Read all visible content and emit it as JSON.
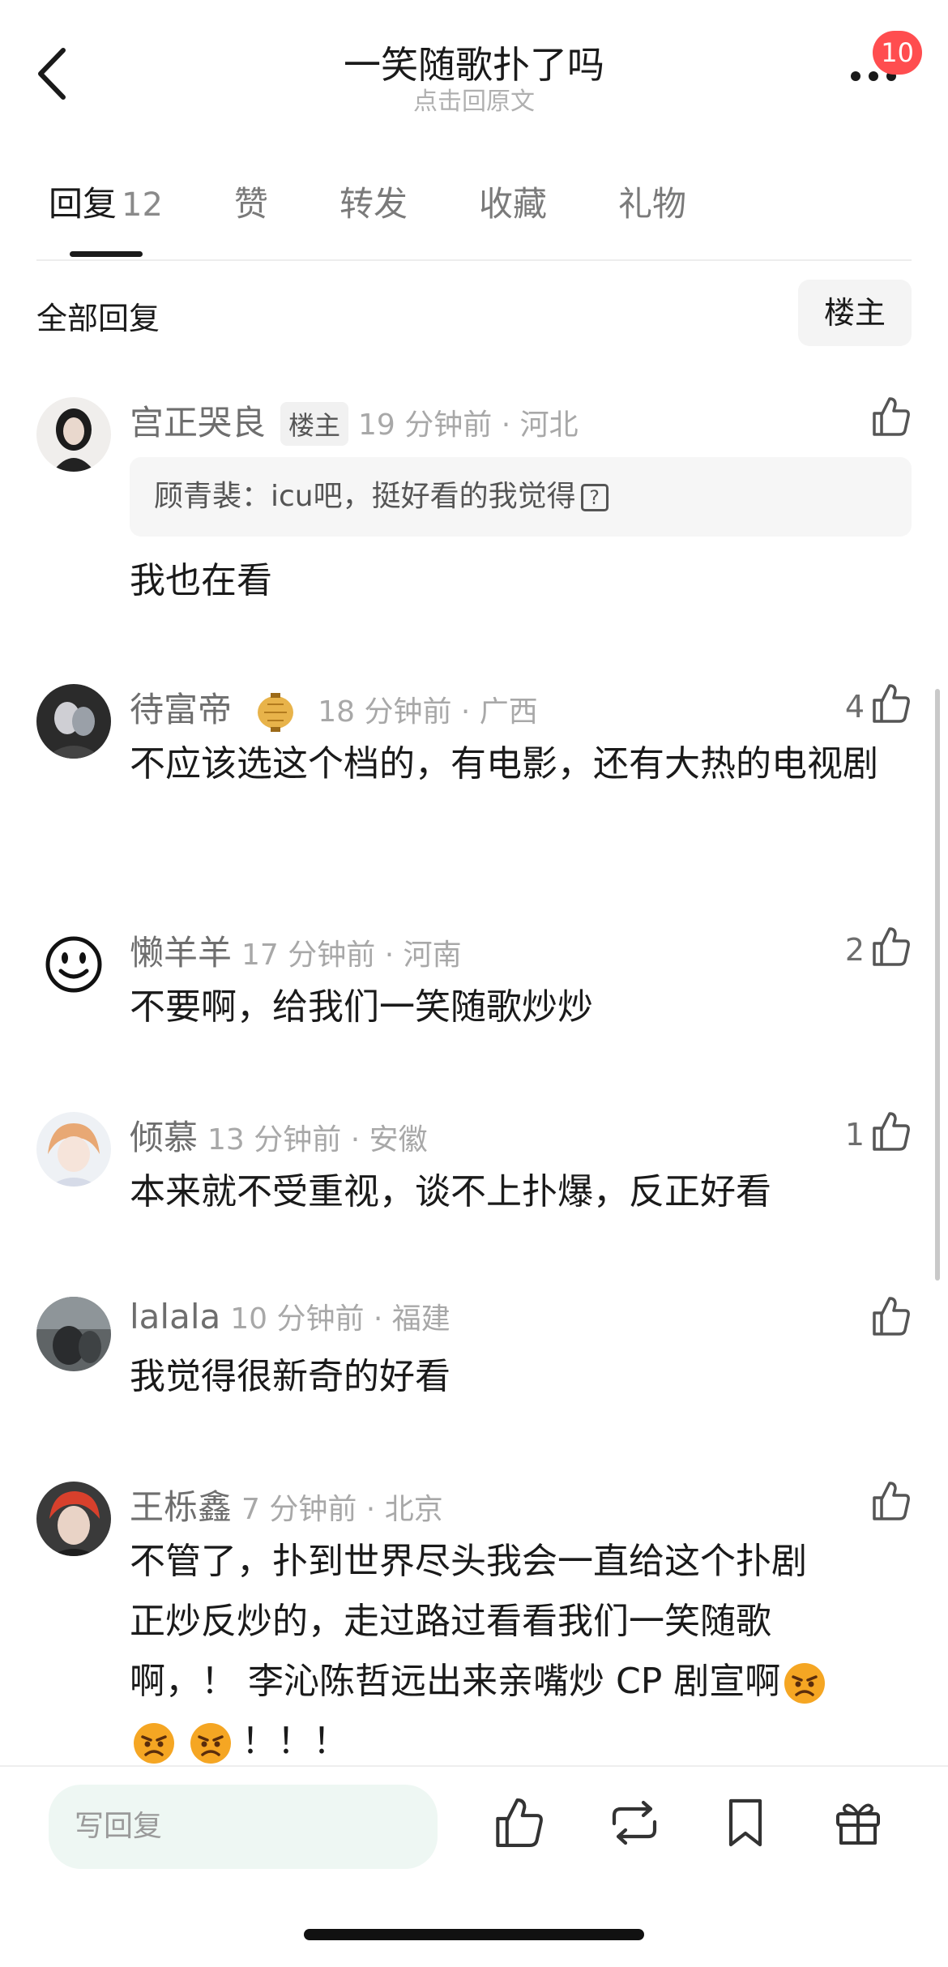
{
  "header": {
    "title": "一笑随歌扑了吗",
    "subtitle": "点击回原文",
    "notification_count": "10"
  },
  "tabs": [
    {
      "label": "回复",
      "count": "12"
    },
    {
      "label": "赞"
    },
    {
      "label": "转发"
    },
    {
      "label": "收藏"
    },
    {
      "label": "礼物"
    }
  ],
  "filter": {
    "label": "全部回复",
    "owner_button": "楼主"
  },
  "comments": [
    {
      "name": "宫正哭良",
      "owner_tag": "楼主",
      "time": "19 分钟前 · 河北",
      "likes": "",
      "quote": "顾青裴：icu吧，挺好看的我觉得",
      "text": "我也在看"
    },
    {
      "name": "待富帝",
      "time": "18 分钟前 · 广西",
      "likes": "4",
      "text": "不应该选这个档的，有电影，还有大热的电视剧"
    },
    {
      "name": "懒羊羊",
      "time": "17 分钟前 · 河南",
      "likes": "2",
      "text": "不要啊，给我们一笑随歌炒炒"
    },
    {
      "name": "倾慕",
      "time": "13 分钟前 · 安徽",
      "likes": "1",
      "text": "本来就不受重视，谈不上扑爆，反正好看"
    },
    {
      "name": "lalala",
      "time": "10 分钟前 · 福建",
      "likes": "",
      "text": "我觉得很新奇的好看"
    },
    {
      "name": "王栎鑫",
      "time": "7 分钟前 · 北京",
      "likes": "",
      "text_line1": "不管了，扑到世界尽头我会一直给这个扑剧",
      "text_line2": "正炒反炒的，走过路过看看我们一笑随歌",
      "text_line3": "啊，！ 李沁陈哲远出来亲嘴炒 CP 剧宣啊",
      "text_line4": "！！！"
    }
  ],
  "bottom_bar": {
    "reply_placeholder": "写回复"
  },
  "colors": {
    "badge": "#ff4d4f",
    "reply_input_bg": "#eef7f3",
    "meta_gray": "#a8a8a8"
  },
  "icons": [
    "back-arrow-icon",
    "more-dots-icon",
    "thumb-up-icon",
    "repost-icon",
    "bookmark-icon",
    "gift-icon",
    "angry-face-emoji",
    "lantern-badge-icon"
  ]
}
